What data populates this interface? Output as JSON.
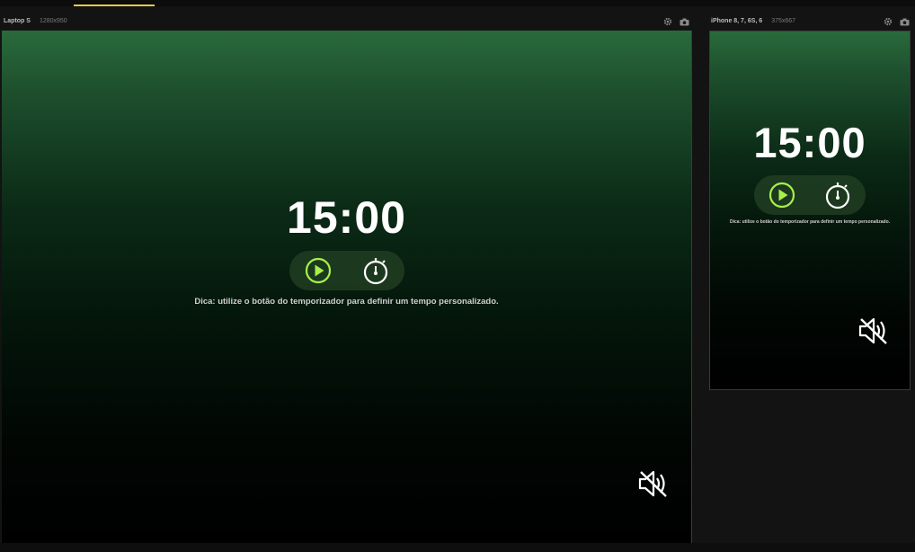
{
  "devices": [
    {
      "name": "Laptop S",
      "size": "1280x950",
      "timer": "15:00",
      "tip": "Dica: utilize o botão do temporizador para definir um tempo personalizado."
    },
    {
      "name": "iPhone 8, 7, 6S, 6",
      "size": "375x667",
      "timer": "15:00",
      "tip": "Dica: utilize o botão do temporizador para definir um tempo personalizado."
    }
  ],
  "icons": {
    "settings": "gear-icon",
    "screenshot": "camera-icon",
    "play": "play-icon",
    "timer": "stopwatch-icon",
    "mute": "speaker-muted-icon"
  },
  "colors": {
    "accent": "#a6f04a",
    "tab_indicator": "#e6c84a",
    "gradient_top": "#2a6a3c",
    "gradient_bottom": "#000000"
  }
}
